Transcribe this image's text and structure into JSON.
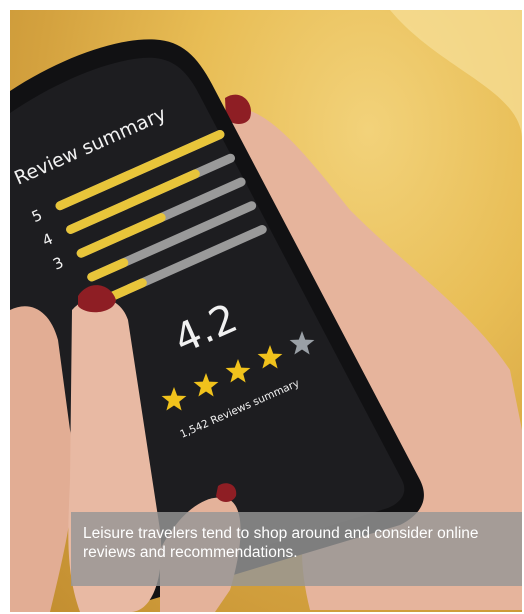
{
  "phone_screen": {
    "title": "Review summary",
    "rating_rows": [
      {
        "label": "5",
        "fill": 1.0
      },
      {
        "label": "4",
        "fill": 0.78
      },
      {
        "label": "3",
        "fill": 0.5
      },
      {
        "label": "",
        "fill": 0.2
      },
      {
        "label": "",
        "fill": 0.25
      }
    ],
    "score": "4.2",
    "stars": {
      "filled": 4,
      "total": 5
    },
    "reviews_text": "1,542 Reviews summary"
  },
  "caption": {
    "text": "Leisure travelers tend to shop around and consider online reviews and recommendations."
  },
  "colors": {
    "bar_fill": "#e8c53a",
    "bar_track": "#9a9a9a",
    "screen": "#1b1b1d",
    "star_filled": "#f0c21c",
    "star_empty": "#9aa0a6",
    "nail": "#8e1e24",
    "skin": "#e8b9a3"
  }
}
